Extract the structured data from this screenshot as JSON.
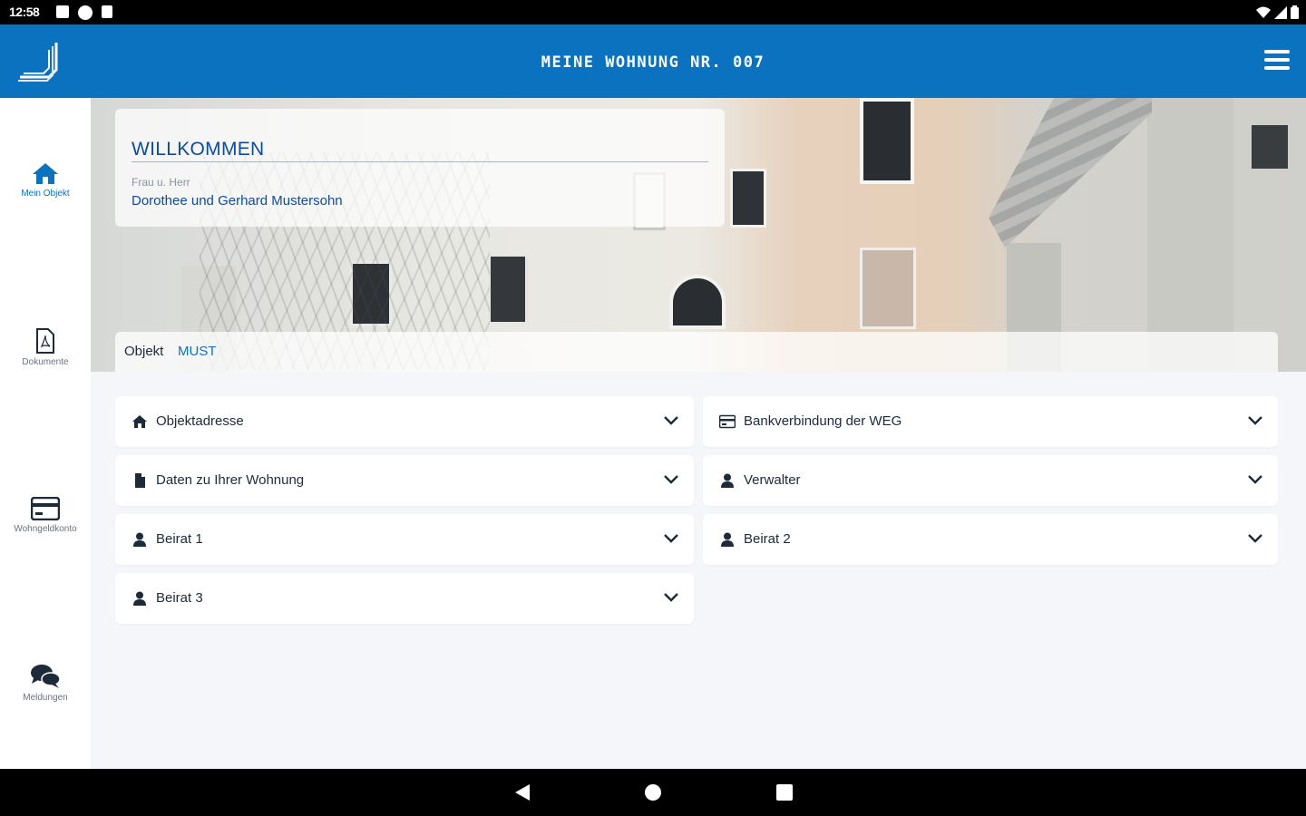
{
  "status_bar": {
    "time": "12:58"
  },
  "app_bar": {
    "title": "MEINE WOHNUNG NR. 007"
  },
  "sidebar": {
    "items": [
      {
        "label": "Mein Objekt",
        "icon": "home-icon"
      },
      {
        "label": "Dokumente",
        "icon": "pdf-document-icon"
      },
      {
        "label": "Wohngeldkonto",
        "icon": "credit-card-icon"
      },
      {
        "label": "Meldungen",
        "icon": "chat-bubbles-icon"
      }
    ]
  },
  "welcome": {
    "title": "WILLKOMMEN",
    "salutation": "Frau u. Herr",
    "names": "Dorothee und Gerhard Mustersohn"
  },
  "object": {
    "label": "Objekt",
    "value": "MUST"
  },
  "accordions": [
    {
      "label": "Objektadresse",
      "icon": "home-icon"
    },
    {
      "label": "Bankverbindung der WEG",
      "icon": "credit-card-icon"
    },
    {
      "label": "Daten zu Ihrer Wohnung",
      "icon": "file-icon"
    },
    {
      "label": "Verwalter",
      "icon": "user-icon"
    },
    {
      "label": "Beirat 1",
      "icon": "user-icon"
    },
    {
      "label": "Beirat 2",
      "icon": "user-icon"
    },
    {
      "label": "Beirat 3",
      "icon": "user-icon"
    }
  ],
  "colors": {
    "primary": "#0b72c0",
    "accent_text": "#0d4c9b",
    "background": "#f4f6fa"
  }
}
